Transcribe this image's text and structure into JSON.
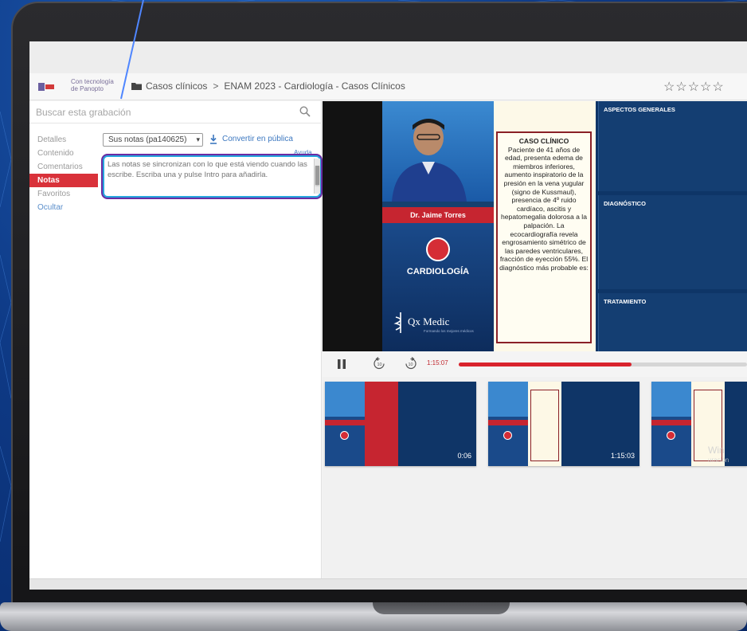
{
  "header": {
    "brand_line1": "Con tecnología",
    "brand_line2": "de Panopto",
    "breadcrumb_folder": "Casos clínicos",
    "breadcrumb_separator": ">",
    "breadcrumb_title": "ENAM 2023 - Cardiología - Casos Clínicos",
    "rating_stars": "☆☆☆☆☆"
  },
  "search": {
    "placeholder": "Buscar esta grabación"
  },
  "sidebar": {
    "items": [
      {
        "label": "Detalles",
        "active": false
      },
      {
        "label": "Contenido",
        "active": false
      },
      {
        "label": "Comentarios",
        "active": false
      },
      {
        "label": "Notas",
        "active": true
      },
      {
        "label": "Favoritos",
        "active": false
      },
      {
        "label": "Ocultar",
        "active": false
      }
    ]
  },
  "notes": {
    "selected_channel": "Sus notas (pa140625)",
    "convert_label": "Convertir en pública",
    "help_label": "Ayuda",
    "placeholder": "Las notas se sincronizan con lo que está viendo cuando las escribe. Escriba una y pulse Intro para añadirla."
  },
  "video": {
    "doctor_name": "Dr. Jaime Torres",
    "specialty": "CARDIOLOGÍA",
    "brand": "Qx Medic",
    "brand_tagline": "Formando los mejores médicos",
    "case_title": "CASO CLÍNICO",
    "case_text": "Paciente de 41 años de edad, presenta edema de miembros inferiores, aumento inspiratorio de la presión en la vena yugular (signo de Kussmaul), presencia de 4º ruido cardíaco, ascitis y hepatomegalia dolorosa a la palpación. La ecocardiografía revela engrosamiento simétrico de las paredes ventriculares, fracción de eyección 55%. El diagnóstico más probable es:",
    "panels": [
      "ASPECTOS GENERALES",
      "DIAGNÓSTICO",
      "TRATAMIENTO"
    ]
  },
  "controls": {
    "current_time": "1:15:07",
    "progress": 0.6,
    "rewind_seconds": "10",
    "forward_seconds": "10"
  },
  "thumbnails": [
    {
      "time": "0:06"
    },
    {
      "time": "1:15:03"
    },
    {
      "time": ""
    }
  ],
  "watermark": {
    "line1": "Win",
    "line2": "uración"
  },
  "colors": {
    "accent_red": "#d9323a",
    "link_blue": "#3d78c0",
    "highlight_purple": "#6a2ca3",
    "highlight_cyan": "#27a6de",
    "video_navy": "#0e3567"
  }
}
